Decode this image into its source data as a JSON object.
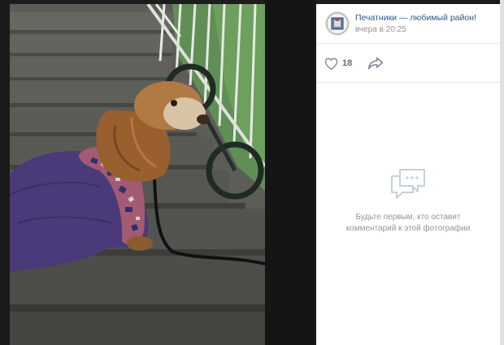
{
  "post": {
    "community_name": "Печатники — любимый район!",
    "time": "вчера в 20:25",
    "likes": "18"
  },
  "comments": {
    "empty_line1": "Будьте первым, кто оставит",
    "empty_line2": "комментарий к этой фотографии"
  },
  "icons": {
    "like": "heart-icon",
    "share": "share-arrow-icon",
    "comments": "comments-bubble-icon"
  },
  "colors": {
    "link": "#2a5885",
    "muted": "#939393",
    "backdrop": "#1c1c1c"
  }
}
